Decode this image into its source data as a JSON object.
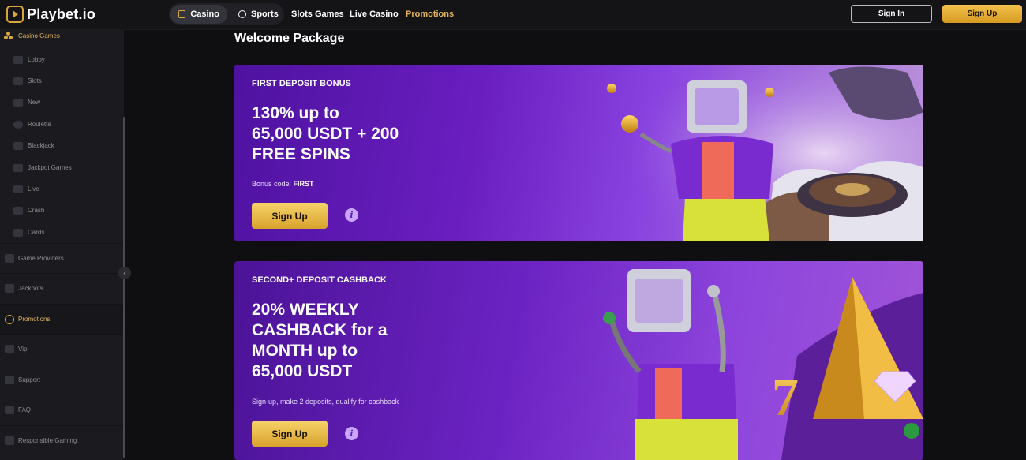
{
  "header": {
    "logo_text": "Playbet.io",
    "segment": [
      {
        "label": "Casino",
        "active": true
      },
      {
        "label": "Sports",
        "active": false
      }
    ],
    "nav": [
      "Slots Games",
      "Live Casino",
      "Promotions"
    ],
    "signin_label": "Sign In",
    "signup_label": "Sign Up",
    "accent": "#d9a63b"
  },
  "sidebar": {
    "heading": "Casino Games",
    "sub_items": [
      "Lobby",
      "Slots",
      "New",
      "Roulette",
      "Blackjack",
      "Jackpot Games",
      "Live",
      "Crash",
      "Cards"
    ],
    "main_items": [
      "Game Providers",
      "Jackpots",
      "Promotions",
      "Vip",
      "Support",
      "FAQ",
      "Responsible Gaming"
    ],
    "active_main": "Promotions"
  },
  "main": {
    "title": "Welcome Package",
    "cards": [
      {
        "kicker": "FIRST DEPOSIT BONUS",
        "headline": "130% up to\n65,000 USDT + 200\nFREE SPINS",
        "note_prefix": "Bonus code: ",
        "note_code": "FIRST",
        "cta": "Sign Up",
        "info": "i"
      },
      {
        "kicker": "SECOND+ DEPOSIT CASHBACK",
        "headline": "20% WEEKLY\nCASHBACK for a\nMONTH up to\n65,000 USDT",
        "note": "Sign-up, make 2 deposits, qualify for cashback",
        "cta": "Sign Up",
        "info": "i"
      }
    ]
  }
}
